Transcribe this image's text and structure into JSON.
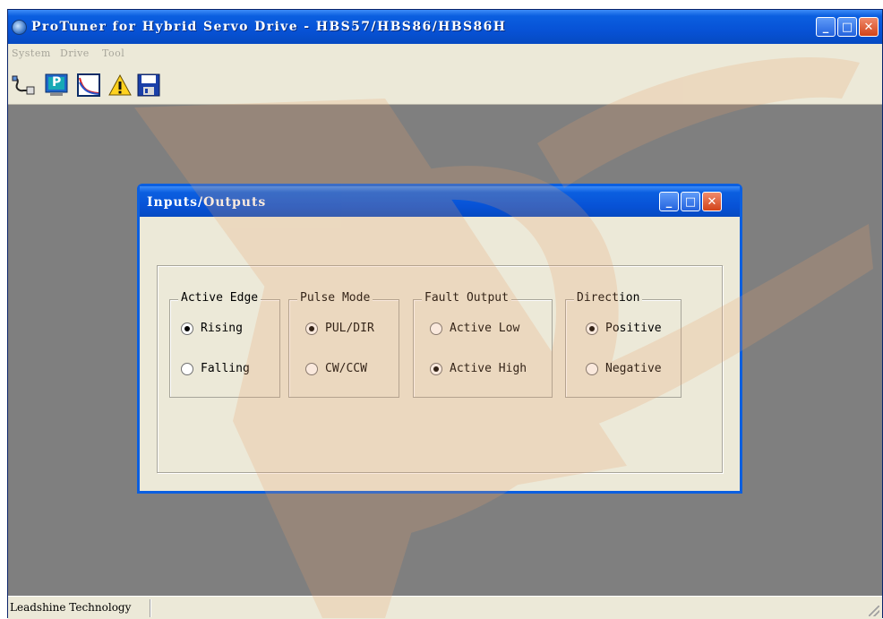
{
  "app": {
    "title": "ProTuner for Hybrid Servo Drive - HBS57/HBS86/HBS86H",
    "caption_buttons": {
      "minimize": "_",
      "maximize": "□",
      "close": "✕"
    }
  },
  "menu": [
    "System",
    "Drive",
    "Tool"
  ],
  "toolbar": {
    "icons": [
      "connect-cable-icon",
      "parameters-icon",
      "oscilloscope-icon",
      "warning-icon",
      "save-icon"
    ],
    "p_label": "P"
  },
  "io_window": {
    "title": "Inputs/Outputs",
    "groups": {
      "active_edge": {
        "label": "Active Edge",
        "options": [
          "Rising",
          "Falling"
        ],
        "selected": "Rising"
      },
      "pulse_mode": {
        "label": "Pulse Mode",
        "options": [
          "PUL/DIR",
          "CW/CCW"
        ],
        "selected": "PUL/DIR"
      },
      "fault_output": {
        "label": "Fault Output",
        "options": [
          "Active Low",
          "Active High"
        ],
        "selected": "Active High"
      },
      "direction": {
        "label": "Direction",
        "options": [
          "Positive",
          "Negative"
        ],
        "selected": "Positive"
      }
    }
  },
  "status": {
    "text": "Leadshine Technology"
  },
  "colors": {
    "titlebar": "#0752d6",
    "face": "#ece9d8",
    "workspace": "#7f7f7f",
    "close": "#d2431a",
    "watermark": "#e9a06a"
  }
}
